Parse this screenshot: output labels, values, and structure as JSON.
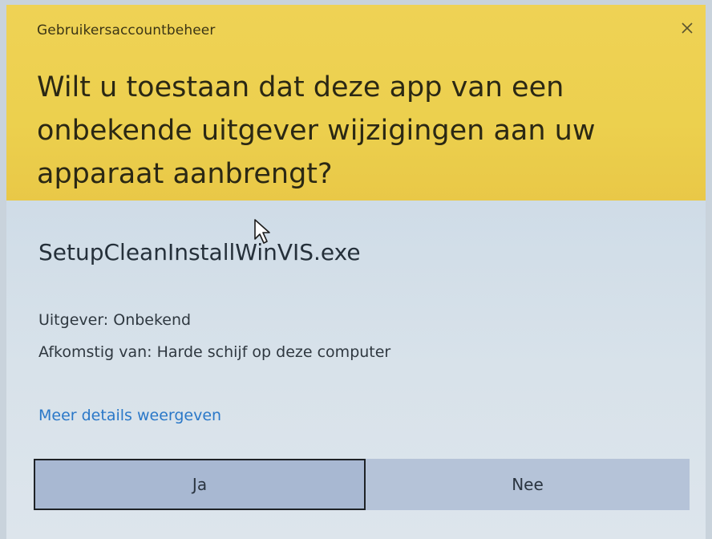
{
  "dialog": {
    "window_title": "Gebruikersaccountbeheer",
    "question": "Wilt u toestaan dat deze app van een onbekende uitgever wijzigingen aan uw apparaat aanbrengt?",
    "program_name": "SetupCleanInstallWinVIS.exe",
    "publisher": "Uitgever: Onbekend",
    "origin": "Afkomstig van: Harde schijf op deze computer",
    "details_link": "Meer details weergeven",
    "yes_label": "Ja",
    "no_label": "Nee",
    "close_icon": "close-icon",
    "cursor_icon": "mouse-pointer-icon",
    "colors": {
      "header_bg": "#ecd04e",
      "body_bg": "#d7e0e8",
      "link": "#2a78c8",
      "button_bg": "#b5c3d8"
    }
  }
}
